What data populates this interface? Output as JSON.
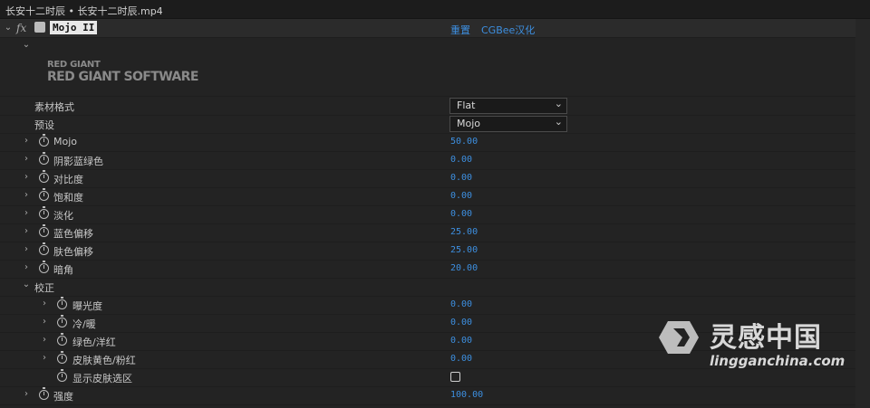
{
  "title": "长安十二时辰 • 长安十二时辰.mp4",
  "effect": {
    "fx_label": "fx",
    "name": "Mojo II",
    "reset_label": "重置",
    "about_label": "CGBee汉化"
  },
  "logo": {
    "line1": "RED GIANT",
    "line2": "RED GIANT SOFTWARE"
  },
  "dropdowns": [
    {
      "label": "素材格式",
      "value": "Flat"
    },
    {
      "label": "预设",
      "value": "Mojo"
    }
  ],
  "params": [
    {
      "label": "Mojo",
      "value": "50.00"
    },
    {
      "label": "阴影蓝绿色",
      "value": "0.00"
    },
    {
      "label": "对比度",
      "value": "0.00"
    },
    {
      "label": "饱和度",
      "value": "0.00"
    },
    {
      "label": "淡化",
      "value": "0.00"
    },
    {
      "label": "蓝色偏移",
      "value": "25.00"
    },
    {
      "label": "肤色偏移",
      "value": "25.00"
    },
    {
      "label": "暗角",
      "value": "20.00"
    }
  ],
  "group": {
    "label": "校正",
    "params": [
      {
        "label": "曝光度",
        "value": "0.00"
      },
      {
        "label": "冷/暖",
        "value": "0.00"
      },
      {
        "label": "绿色/洋红",
        "value": "0.00"
      },
      {
        "label": "皮肤黄色/粉红",
        "value": "0.00"
      }
    ],
    "checkbox": {
      "label": "显示皮肤选区",
      "checked": false
    }
  },
  "strength": {
    "label": "强度",
    "value": "100.00"
  },
  "watermark": {
    "cn": "灵感中国",
    "url": "lingganchina.com"
  },
  "colors": {
    "accent": "#3d8fe0",
    "background": "#232323"
  }
}
